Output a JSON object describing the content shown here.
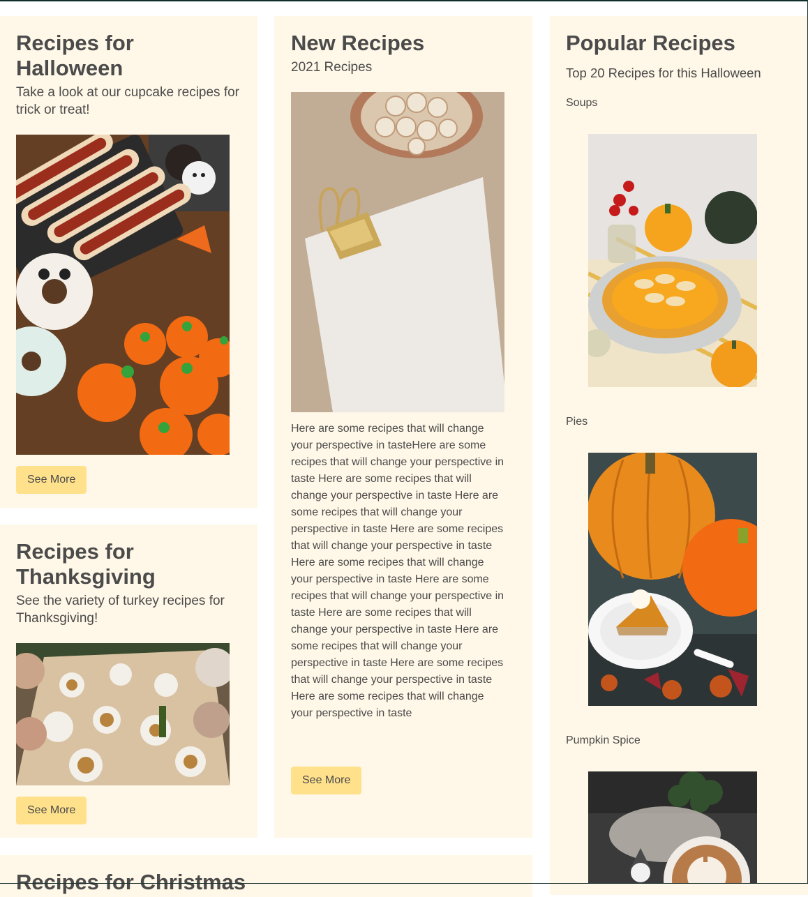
{
  "halloween": {
    "title": "Recipes for Halloween",
    "subtitle": "Take a look at our cupcake recipes for trick or treat!",
    "button": "See More"
  },
  "thanksgiving": {
    "title": "Recipes for Thanksgiving",
    "subtitle": "See the variety of turkey recipes for Thanksgiving!",
    "button": "See More"
  },
  "christmas": {
    "title": "Recipes for Christmas"
  },
  "new_recipes": {
    "title": "New Recipes",
    "subtitle": "2021 Recipes",
    "body": "Here are some recipes that will change your perspective in tasteHere are some recipes that will change your perspective in taste Here are some recipes that will change your perspective in taste Here are some recipes that will change your perspective in taste Here are some recipes that will change your perspective in taste Here are some recipes that will change your perspective in taste Here are some recipes that will change your perspective in taste Here are some recipes that will change your perspective in taste Here are some recipes that will change your perspective in taste Here are some recipes that will change your perspective in taste Here are some recipes that will change your perspective in taste",
    "button": "See More"
  },
  "popular": {
    "title": "Popular Recipes",
    "subtitle": "Top 20 Recipes for this Halloween",
    "items": [
      {
        "label": "Soups"
      },
      {
        "label": "Pies"
      },
      {
        "label": "Pumpkin Spice"
      }
    ]
  },
  "colors": {
    "card_bg": "#fff8e8",
    "button_bg": "#ffe18c",
    "text": "#4a4a4a"
  }
}
